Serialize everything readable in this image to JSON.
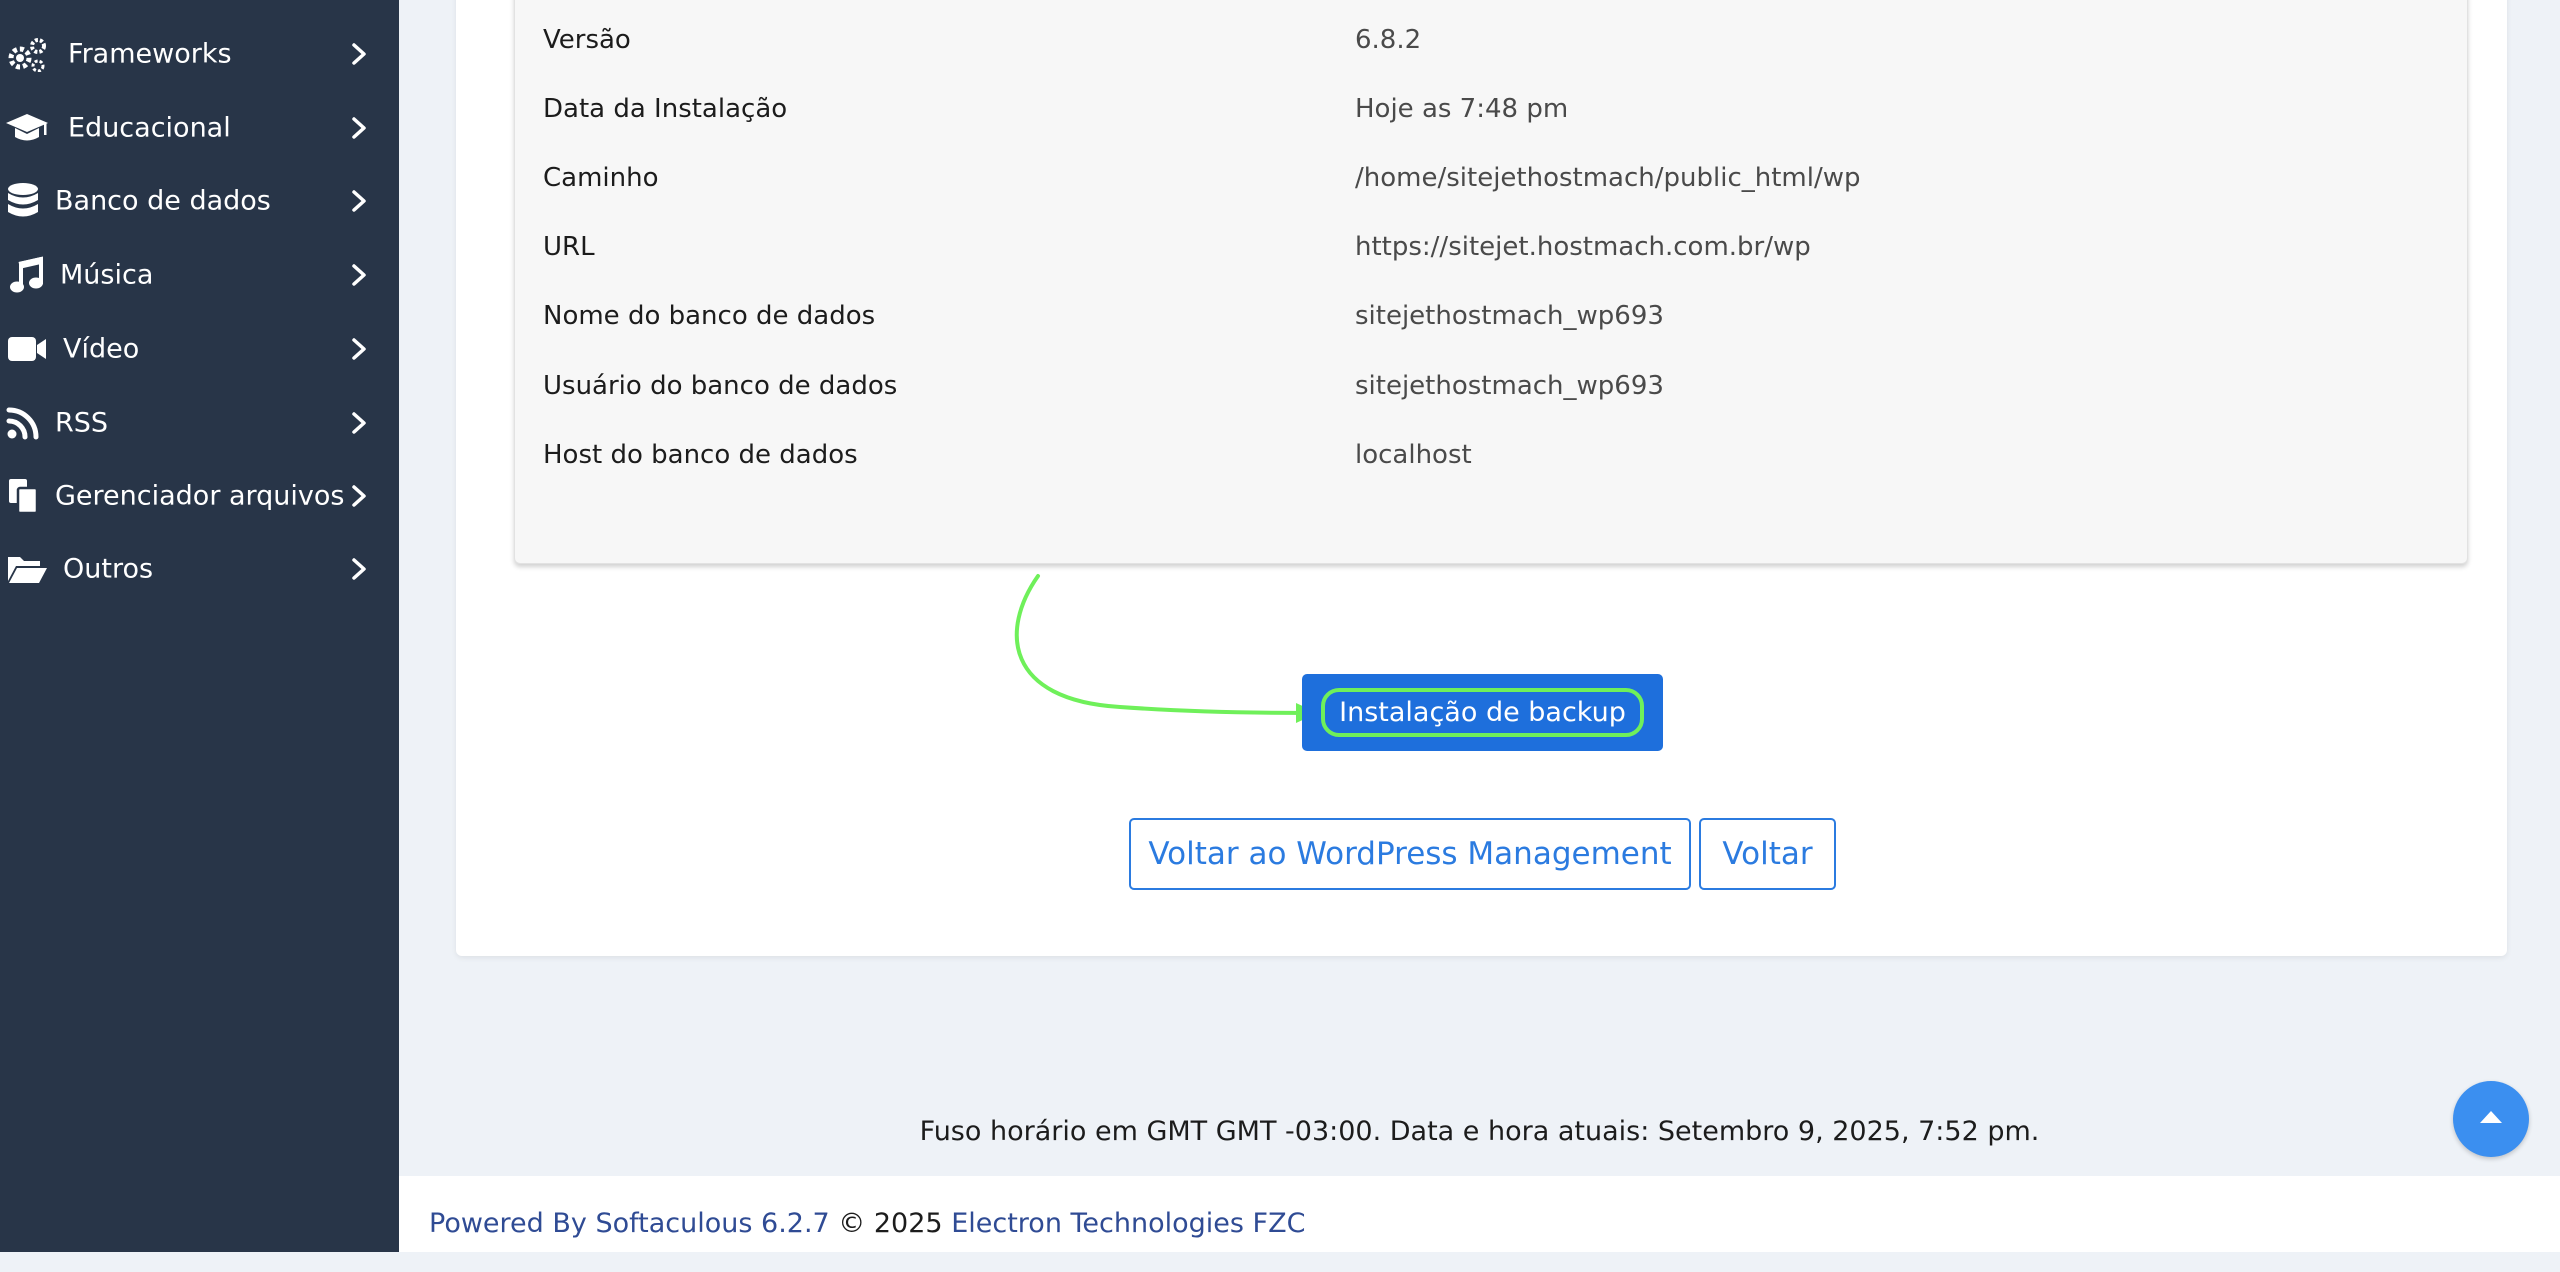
{
  "sidebar": {
    "items": [
      {
        "label": "Frameworks",
        "icon": "gears-icon"
      },
      {
        "label": "Educacional",
        "icon": "graduation-cap-icon"
      },
      {
        "label": "Banco de dados",
        "icon": "database-icon"
      },
      {
        "label": "Música",
        "icon": "music-note-icon"
      },
      {
        "label": "Vídeo",
        "icon": "video-camera-icon"
      },
      {
        "label": "RSS",
        "icon": "rss-icon"
      },
      {
        "label": "Gerenciador arquivos",
        "icon": "files-icon"
      },
      {
        "label": "Outros",
        "icon": "folder-open-icon"
      }
    ]
  },
  "details": {
    "rows": [
      {
        "key": "Versão",
        "value": "6.8.2"
      },
      {
        "key": "Data da Instalação",
        "value": "Hoje as 7:48 pm"
      },
      {
        "key": "Caminho",
        "value": "/home/sitejethostmach/public_html/wp"
      },
      {
        "key": "URL",
        "value": "https://sitejet.hostmach.com.br/wp"
      },
      {
        "key": "Nome do banco de dados",
        "value": "sitejethostmach_wp693"
      },
      {
        "key": "Usuário do banco de dados",
        "value": "sitejethostmach_wp693"
      },
      {
        "key": "Host do banco de dados",
        "value": "localhost"
      }
    ]
  },
  "actions": {
    "backup_label": "Instalação de backup",
    "back_wp_label": "Voltar ao WordPress Management",
    "back_label": "Voltar"
  },
  "timezone_text": "Fuso horário em GMT GMT -03:00. Data e hora atuais: Setembro 9, 2025, 7:52 pm.",
  "footer": {
    "powered_by": "Powered By Softaculous 6.2.7",
    "copyright": " © 2025 ",
    "company": "Electron Technologies FZC"
  },
  "colors": {
    "sidebar_bg": "#283548",
    "primary": "#1e6fdc",
    "highlight": "#6ff05a",
    "link": "#2f4b94"
  }
}
